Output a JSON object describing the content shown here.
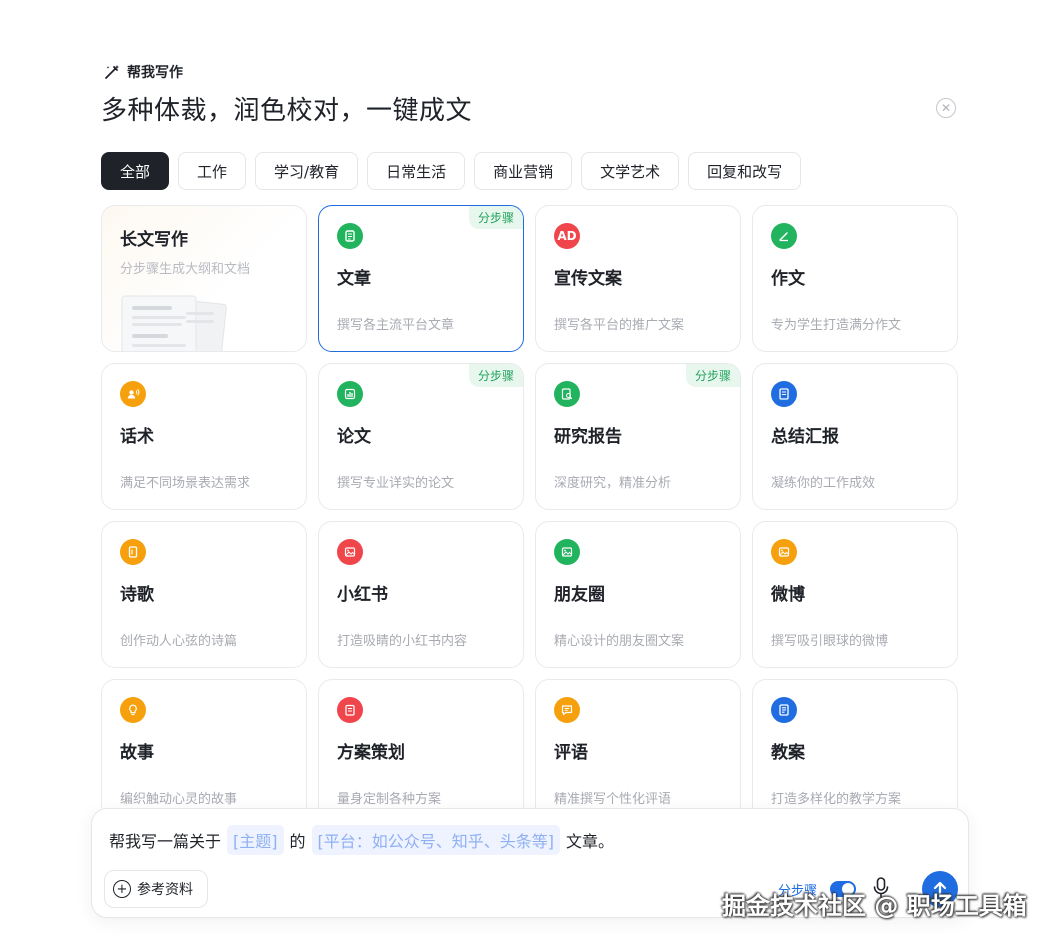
{
  "header": {
    "tag": "帮我写作",
    "headline": "多种体裁，润色校对，一键成文"
  },
  "tabs": [
    {
      "label": "全部",
      "active": true
    },
    {
      "label": "工作",
      "active": false
    },
    {
      "label": "学习/教育",
      "active": false
    },
    {
      "label": "日常生活",
      "active": false
    },
    {
      "label": "商业营销",
      "active": false
    },
    {
      "label": "文学艺术",
      "active": false
    },
    {
      "label": "回复和改写",
      "active": false
    }
  ],
  "cards": [
    {
      "title": "长文写作",
      "desc": "分步骤生成大纲和文档",
      "icon": "document-stack-icon",
      "color": "",
      "badge": ""
    },
    {
      "title": "文章",
      "desc": "撰写各主流平台文章",
      "icon": "article-icon",
      "color": "#22b35e",
      "badge": "分步骤"
    },
    {
      "title": "宣传文案",
      "desc": "撰写各平台的推广文案",
      "icon": "ad-icon",
      "color": "#f0454a",
      "badge": "",
      "icon_text": "AD"
    },
    {
      "title": "作文",
      "desc": "专为学生打造满分作文",
      "icon": "pen-icon",
      "color": "#22b35e",
      "badge": ""
    },
    {
      "title": "话术",
      "desc": "满足不同场景表达需求",
      "icon": "speaker-icon",
      "color": "#f5a00c",
      "badge": ""
    },
    {
      "title": "论文",
      "desc": "撰写专业详实的论文",
      "icon": "bar-chart-icon",
      "color": "#22b35e",
      "badge": "分步骤"
    },
    {
      "title": "研究报告",
      "desc": "深度研究，精准分析",
      "icon": "report-search-icon",
      "color": "#22b35e",
      "badge": "分步骤"
    },
    {
      "title": "总结汇报",
      "desc": "凝练你的工作成效",
      "icon": "notebook-icon",
      "color": "#1f6de0",
      "badge": ""
    },
    {
      "title": "诗歌",
      "desc": "创作动人心弦的诗篇",
      "icon": "scroll-icon",
      "color": "#f5a00c",
      "badge": ""
    },
    {
      "title": "小红书",
      "desc": "打造吸睛的小红书内容",
      "icon": "image-icon",
      "color": "#f0454a",
      "badge": ""
    },
    {
      "title": "朋友圈",
      "desc": "精心设计的朋友圈文案",
      "icon": "image-icon",
      "color": "#22b35e",
      "badge": ""
    },
    {
      "title": "微博",
      "desc": "撰写吸引眼球的微博",
      "icon": "image-icon",
      "color": "#f5a00c",
      "badge": ""
    },
    {
      "title": "故事",
      "desc": "编织触动心灵的故事",
      "icon": "lightbulb-icon",
      "color": "#f5a00c",
      "badge": ""
    },
    {
      "title": "方案策划",
      "desc": "量身定制各种方案",
      "icon": "clipboard-icon",
      "color": "#f0454a",
      "badge": ""
    },
    {
      "title": "评语",
      "desc": "精准撰写个性化评语",
      "icon": "comment-icon",
      "color": "#f5a00c",
      "badge": ""
    },
    {
      "title": "教案",
      "desc": "打造多样化的教学方案",
      "icon": "lesson-book-icon",
      "color": "#1f6de0",
      "badge": ""
    }
  ],
  "composer": {
    "prefix": "帮我写一篇关于",
    "slot_topic": "[主题]",
    "joiner": "的",
    "slot_platform": "[平台：如公众号、知乎、头条等]",
    "suffix": "文章。",
    "reference_label": "参考资料",
    "step_toggle_label": "分步骤",
    "step_toggle_on": true
  },
  "watermark": "掘金技术社区 @ 职场工具箱"
}
